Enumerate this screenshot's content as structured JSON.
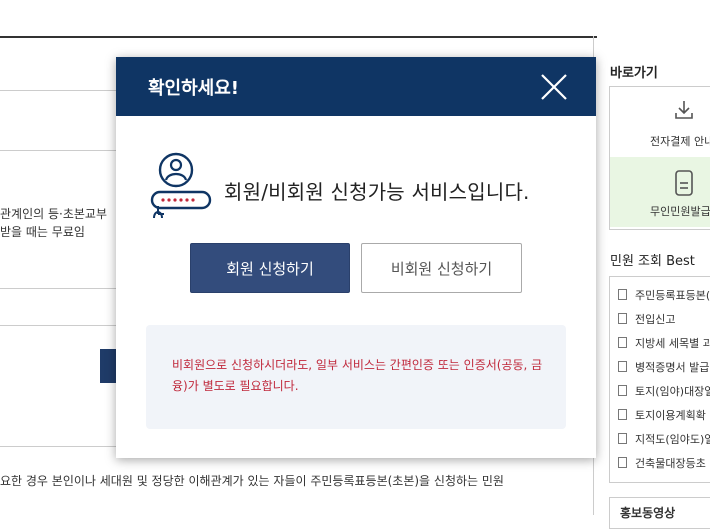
{
  "background": {
    "text_lines": [
      "관계인의 등·초본교부",
      "받을 때는 무료임"
    ],
    "bottom_text": "요한 경우 본인이나 세대원 및 정당한 이해관계가 있는 자들이 주민등록표등본(초본)을 신청하는 민원"
  },
  "right_panel": {
    "shortcut_title": "바로가기",
    "shortcuts": [
      {
        "label": "전자결제 안내",
        "icon": "download-icon"
      },
      {
        "label": "무인민원발급",
        "icon": "kiosk-icon"
      }
    ],
    "best_title": "민원 조회 Best",
    "best_items": [
      "주민등록표등본(",
      "전입신고",
      "지방세 세목별 과",
      "병적증명서 발급",
      "토지(임야)대장열",
      "토지이용계획확",
      "지적도(임야도)열",
      "건축물대장등초"
    ],
    "bottom_box_title": "홍보동영상"
  },
  "modal": {
    "title": "확인하세요!",
    "close_icon": "close-icon",
    "heading": "회원/비회원 신청가능 서비스입니다.",
    "member_button": "회원 신청하기",
    "nonmember_button": "비회원 신청하기",
    "notice": "비회원으로 신청하시더라도, 일부 서비스는 간편인증 또는 인증서(공동, 금융)가 별도로 필요합니다.",
    "colors": {
      "header": "#0f3564",
      "primary_button": "#334c7c",
      "notice_text": "#c0283b",
      "notice_bg": "#f1f4f9"
    }
  }
}
